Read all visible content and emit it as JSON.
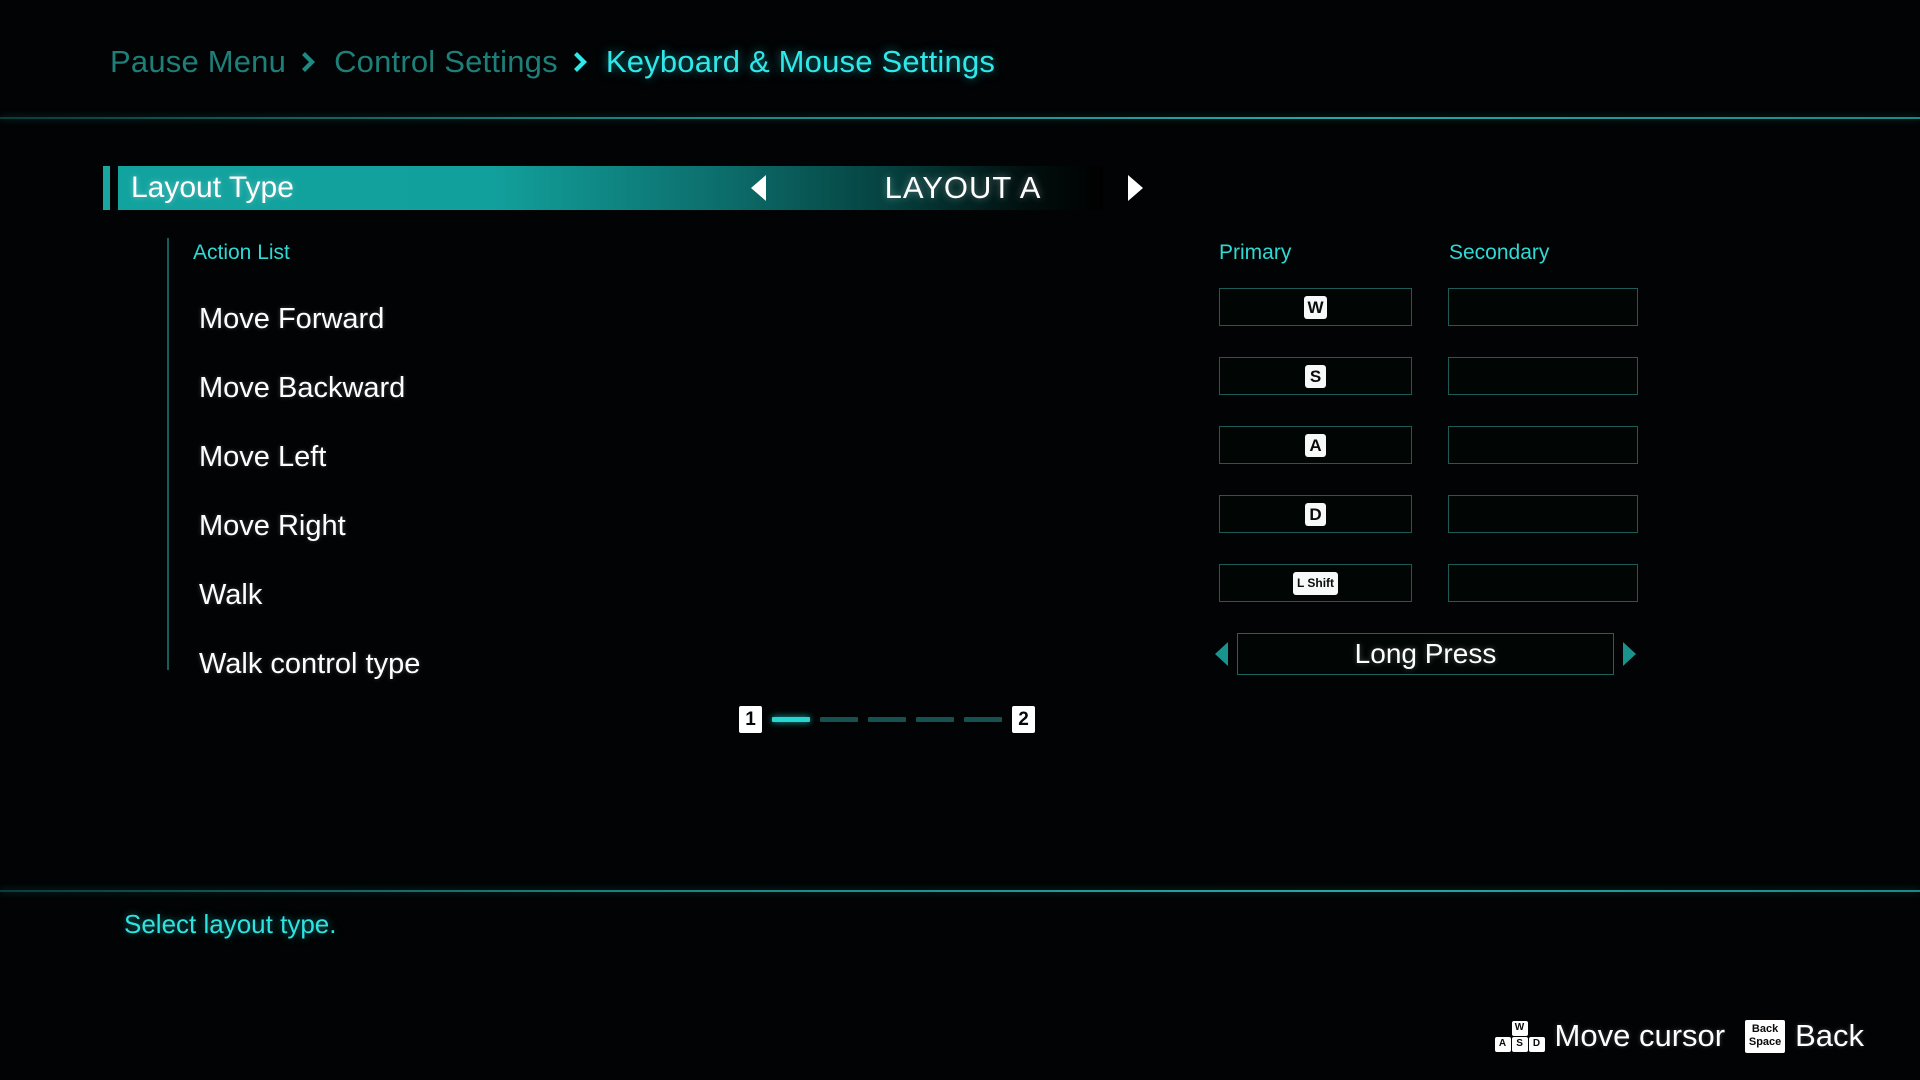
{
  "breadcrumb": {
    "separator_icon": "chevron-right-icon",
    "items": [
      {
        "label": "Pause Menu",
        "state": "dim"
      },
      {
        "label": "Control Settings",
        "state": "dim"
      },
      {
        "label": "Keyboard & Mouse Settings",
        "state": "active"
      }
    ]
  },
  "colors": {
    "accent": "#2fe8ea",
    "accent_dim": "#1e7f79",
    "highlight_fill": "#13a39f",
    "box_border": "#1d5b57",
    "text": "#ffffff",
    "background": "#000000"
  },
  "layout_option": {
    "label": "Layout Type",
    "value": "LAYOUT A",
    "left_arrow_icon": "triangle-left-icon",
    "right_arrow_icon": "triangle-right-icon",
    "selected": true
  },
  "action_table": {
    "list_header": "Action List",
    "columns": {
      "primary": "Primary",
      "secondary": "Secondary"
    },
    "rows": [
      {
        "action": "Move Forward",
        "primary": "W",
        "primary_key_style": "std",
        "secondary": ""
      },
      {
        "action": "Move Backward",
        "primary": "S",
        "primary_key_style": "std",
        "secondary": ""
      },
      {
        "action": "Move Left",
        "primary": "A",
        "primary_key_style": "std",
        "secondary": ""
      },
      {
        "action": "Move Right",
        "primary": "D",
        "primary_key_style": "std",
        "secondary": ""
      },
      {
        "action": "Walk",
        "primary": "L Shift",
        "primary_key_style": "wide",
        "secondary": ""
      }
    ],
    "control_type_row": {
      "action": "Walk control type",
      "value": "Long Press",
      "left_arrow_icon": "triangle-left-icon",
      "right_arrow_icon": "triangle-right-icon"
    }
  },
  "pagination": {
    "start_page": "1",
    "end_page": "2",
    "segments": 5,
    "active_segment": 1
  },
  "description": "Select layout type.",
  "footer_hints": [
    {
      "icon": "wasd-keys-icon",
      "keys": {
        "top": "W",
        "bottom": [
          "A",
          "S",
          "D"
        ]
      },
      "label": "Move cursor"
    },
    {
      "icon": "backspace-key-icon",
      "keys": {
        "line1": "Back",
        "line2": "Space"
      },
      "label": "Back"
    }
  ]
}
